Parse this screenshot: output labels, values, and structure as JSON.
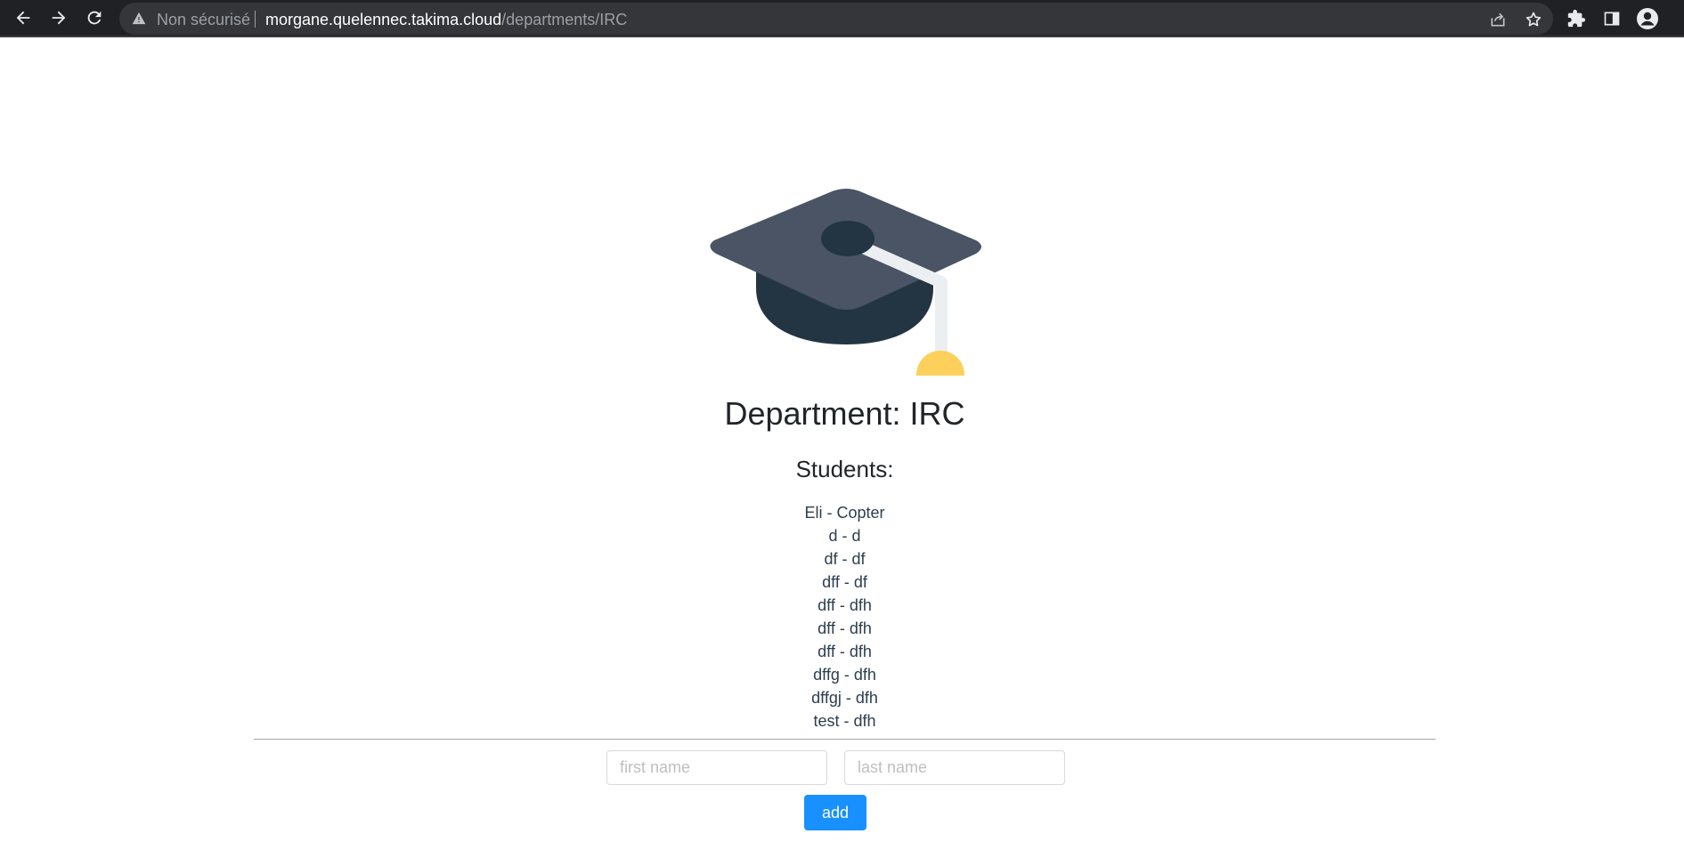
{
  "browser": {
    "security_label": "Non sécurisé",
    "url_host": "morgane.quelennec.takima.cloud",
    "url_path": "/departments/IRC",
    "icons": {
      "back": "arrow-left-icon",
      "forward": "arrow-right-icon",
      "reload": "reload-icon",
      "warning": "warning-triangle-icon",
      "share": "share-icon",
      "bookmark": "star-icon",
      "extensions": "puzzle-icon",
      "side_panel": "side-panel-icon",
      "profile": "profile-icon"
    }
  },
  "page": {
    "logo": "graduation-cap-icon",
    "title": "Department: IRC",
    "students_heading": "Students:",
    "students": [
      "Eli - Copter",
      "d - d",
      "df - df",
      "dff - df",
      "dff - dfh",
      "dff - dfh",
      "dff - dfh",
      "dffg - dfh",
      "dffgj - dfh",
      "test - dfh"
    ],
    "form": {
      "first_name_placeholder": "first name",
      "last_name_placeholder": "last name",
      "first_name_value": "",
      "last_name_value": "",
      "add_label": "add"
    }
  },
  "colors": {
    "chrome_bg": "#202124",
    "omnibox_bg": "#35363a",
    "button_primary": "#1890ff",
    "cap_top": "#4a5464",
    "cap_band": "#233543",
    "tassel_cord": "#eceff1",
    "tassel_ball": "#fcd05a",
    "student_text": "#2c3e50"
  }
}
